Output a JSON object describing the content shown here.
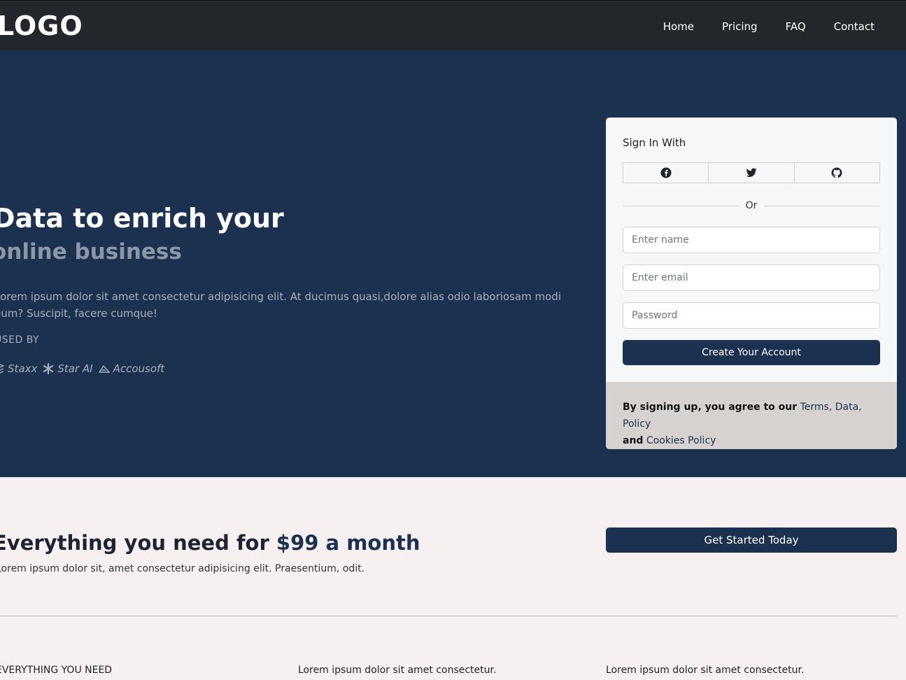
{
  "navbar": {
    "logo": "LOGO",
    "links": [
      "Home",
      "Pricing",
      "FAQ",
      "Contact"
    ]
  },
  "hero": {
    "title": "Data to enrich your",
    "subtitle": "online business",
    "description": "Lorem ipsum dolor sit amet consectetur adipisicing elit. At ducimus quasi,dolore alias odio laboriosam modi eum? Suscipit, facere cumque!",
    "used_by_label": "USED BY",
    "brands": [
      {
        "name": "Staxx",
        "icon": "stack-icon"
      },
      {
        "name": "Star AI",
        "icon": "asterisk-icon"
      },
      {
        "name": "Accousoft",
        "icon": "mountain-icon"
      }
    ]
  },
  "signup": {
    "title": "Sign In With",
    "social": [
      {
        "icon": "facebook-icon"
      },
      {
        "icon": "twitter-icon"
      },
      {
        "icon": "github-icon"
      }
    ],
    "or_text": "Or",
    "name_placeholder": "Enter name",
    "email_placeholder": "Enter email",
    "password_placeholder": "Password",
    "submit_label": "Create Your Account",
    "footer_text": "By signing up, you agree to our",
    "footer_link_terms": "Terms, Data, Policy",
    "footer_and": "and",
    "footer_link_cookies": "Cookies Policy"
  },
  "pricing": {
    "title_prefix": "Everything you need for",
    "price": "$99 a month",
    "description": "Lorem ipsum dolor sit, amet consectetur adipisicing elit. Praesentium, odit.",
    "cta_label": "Get Started Today",
    "features": [
      "EVERYTHING YOU NEED",
      "Lorem ipsum dolor sit amet consectetur.",
      "Lorem ipsum dolor sit amet consectetur."
    ]
  },
  "colors": {
    "navbar_bg": "#23262b",
    "hero_bg": "#1c3050",
    "primary": "#1c3050",
    "page_bg": "#f6f1f0",
    "card_footer_bg": "#d6d2d0"
  }
}
